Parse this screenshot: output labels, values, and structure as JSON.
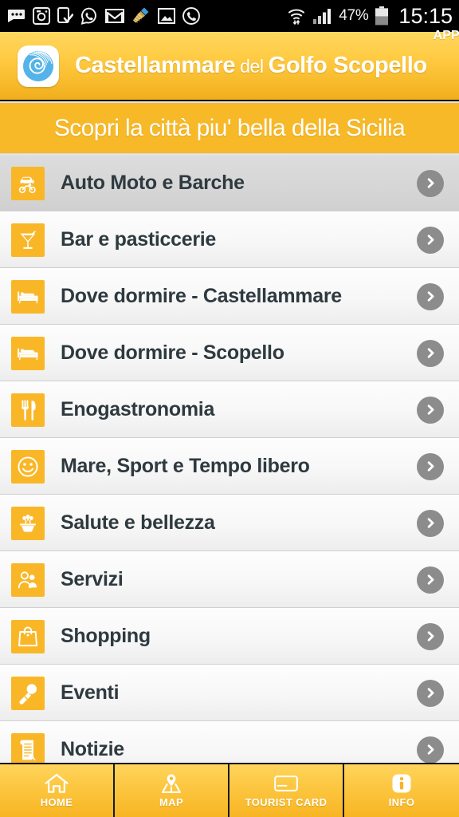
{
  "status_bar": {
    "notification_icons": [
      "message-icon",
      "instagram-icon",
      "download-complete-icon",
      "whatsapp-icon",
      "gmail-icon",
      "broom-cleaner-icon",
      "photo-icon",
      "phone-icon"
    ],
    "wifi_icon": "wifi-transfer-icon",
    "signal_icon": "cellular-signal-icon",
    "battery_percent": "47%",
    "battery_icon": "battery-icon",
    "clock": "15:15"
  },
  "header": {
    "logo_icon": "spiral-shell-logo-icon",
    "title_part1": "Castellammare",
    "title_connector": "del",
    "title_part2": "Golfo Scopello",
    "app_superscript": "APP"
  },
  "subtitle": {
    "text": "Scopri la città piu' bella della Sicilia"
  },
  "list": {
    "items": [
      {
        "label": "Auto Moto e Barche",
        "icon": "car-motorbike-icon",
        "pressed": true
      },
      {
        "label": "Bar e pasticcerie",
        "icon": "cocktail-glass-icon",
        "pressed": false
      },
      {
        "label": "Dove dormire - Castellammare",
        "icon": "bed-icon",
        "pressed": false
      },
      {
        "label": "Dove dormire - Scopello",
        "icon": "bed-icon",
        "pressed": false
      },
      {
        "label": "Enogastronomia",
        "icon": "fork-knife-icon",
        "pressed": false
      },
      {
        "label": "Mare, Sport e Tempo libero",
        "icon": "smiley-face-icon",
        "pressed": false
      },
      {
        "label": "Salute e bellezza",
        "icon": "mortar-pestle-icon",
        "pressed": false
      },
      {
        "label": "Servizi",
        "icon": "people-group-icon",
        "pressed": false
      },
      {
        "label": "Shopping",
        "icon": "shopping-bag-icon",
        "pressed": false
      },
      {
        "label": "Eventi",
        "icon": "microphone-icon",
        "pressed": false
      },
      {
        "label": "Notizie",
        "icon": "scroll-document-icon",
        "pressed": false
      }
    ],
    "chevron_icon": "chevron-right-icon"
  },
  "bottom_nav": {
    "items": [
      {
        "label": "HOME",
        "icon": "home-icon"
      },
      {
        "label": "MAP",
        "icon": "map-pin-icon"
      },
      {
        "label": "TOURIST CARD",
        "icon": "credit-card-icon"
      },
      {
        "label": "INFO",
        "icon": "info-icon"
      }
    ]
  },
  "colors": {
    "brand_yellow": "#f9b728",
    "brand_yellow_light": "#ffd55c",
    "status_bar_bg": "#000000",
    "row_text": "#2e3a3f",
    "chevron_gray": "#8c8c8c",
    "logo_blue": "#4aa8e0"
  }
}
